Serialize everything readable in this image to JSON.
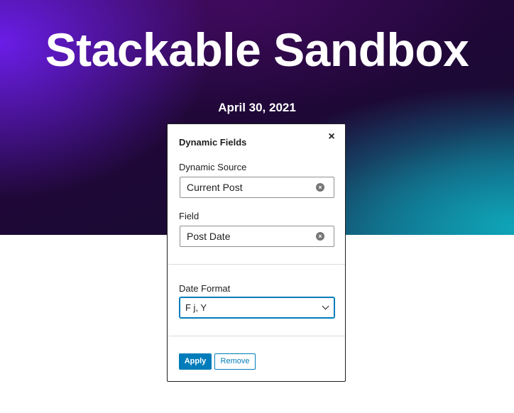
{
  "hero": {
    "title": "Stackable Sandbox",
    "date": "April 30, 2021"
  },
  "popover": {
    "title": "Dynamic Fields",
    "close_icon": "×",
    "dynamic_source": {
      "label": "Dynamic Source",
      "value": "Current Post",
      "clear_icon": "×"
    },
    "field": {
      "label": "Field",
      "value": "Post Date",
      "clear_icon": "×"
    },
    "date_format": {
      "label": "Date Format",
      "value": "F j, Y"
    },
    "apply_label": "Apply",
    "remove_label": "Remove"
  },
  "colors": {
    "accent": "#007cba",
    "hero_purple": "#200838",
    "hero_teal": "#0fa5b9"
  }
}
